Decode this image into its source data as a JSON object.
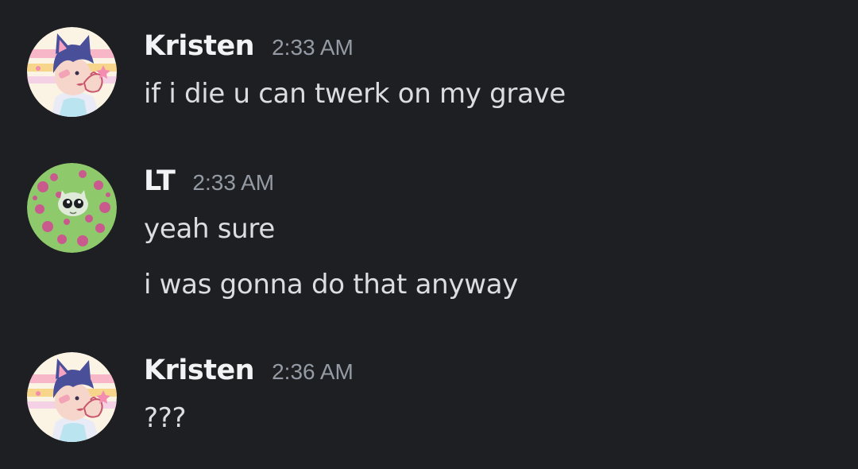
{
  "colors": {
    "background": "#1e1f22",
    "author_name": "#f2f3f5",
    "timestamp": "#949ba4",
    "message_text": "#dbdee1"
  },
  "groups": [
    {
      "author": "Kristen",
      "time": "2:33 AM",
      "avatar_icon": "kristen-avatar",
      "messages": [
        "if i die u can twerk on my grave"
      ]
    },
    {
      "author": "LT",
      "time": "2:33 AM",
      "avatar_icon": "lt-avatar",
      "messages": [
        "yeah sure",
        "i was gonna do that anyway"
      ]
    },
    {
      "author": "Kristen",
      "time": "2:36 AM",
      "avatar_icon": "kristen-avatar",
      "messages": [
        "???"
      ]
    }
  ]
}
